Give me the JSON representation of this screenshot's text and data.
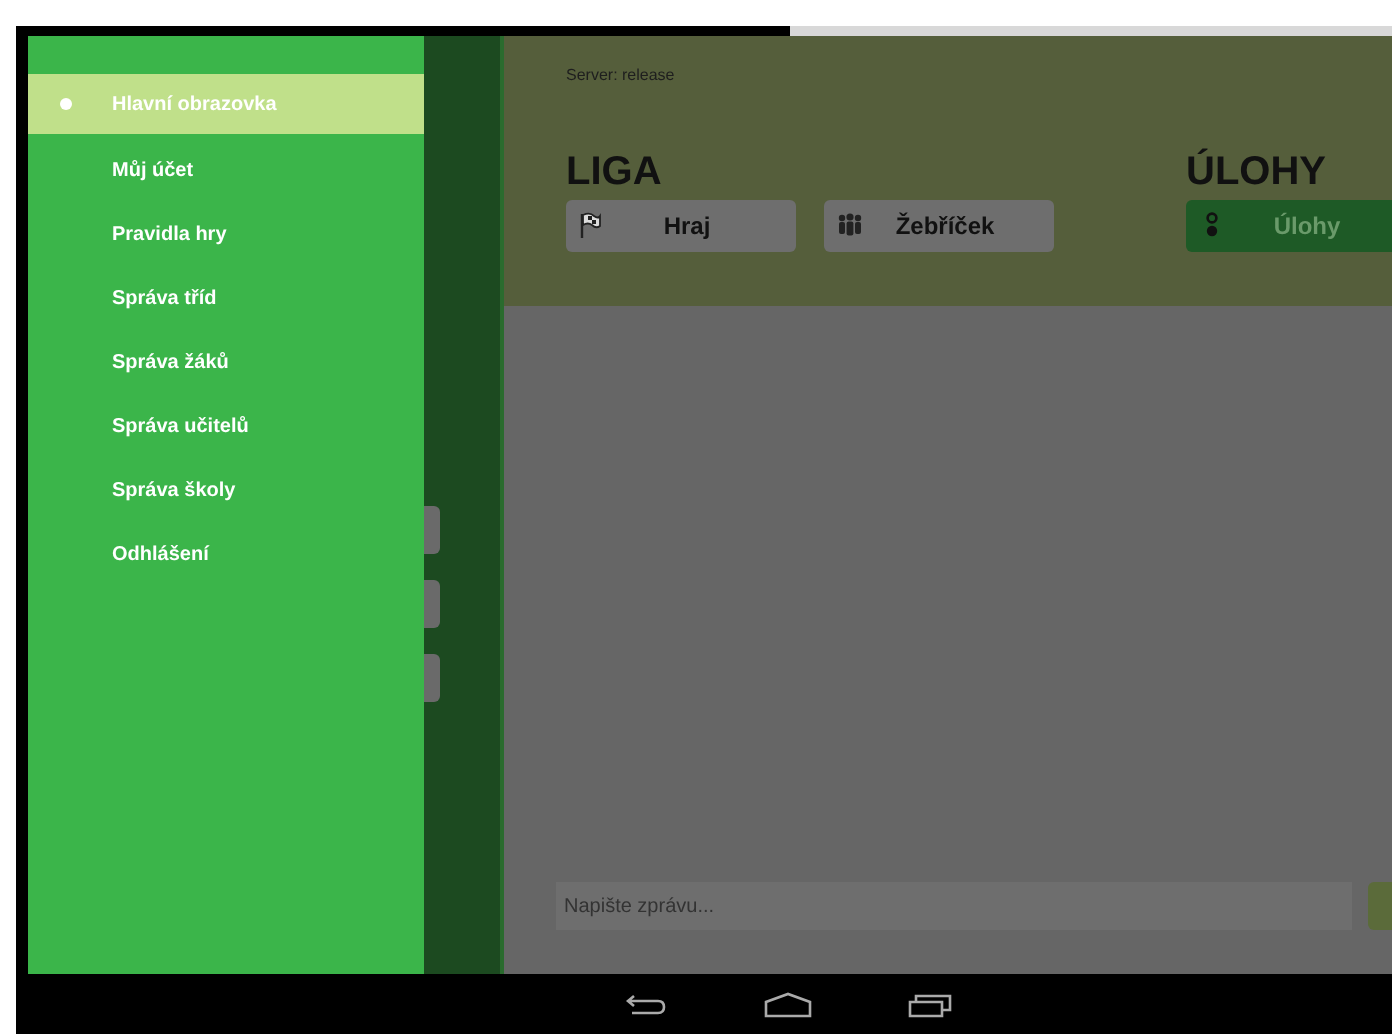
{
  "drawer": {
    "items": [
      {
        "label": "Hlavní obrazovka",
        "selected": true
      },
      {
        "label": "Můj účet",
        "selected": false
      },
      {
        "label": "Pravidla hry",
        "selected": false
      },
      {
        "label": "Správa tříd",
        "selected": false
      },
      {
        "label": "Správa žáků",
        "selected": false
      },
      {
        "label": "Správa učitelů",
        "selected": false
      },
      {
        "label": "Správa školy",
        "selected": false
      },
      {
        "label": "Odhlášení",
        "selected": false
      }
    ]
  },
  "header": {
    "server": "Server: release"
  },
  "sections": [
    {
      "title": "LIGA",
      "buttons": [
        {
          "label": "Hraj",
          "kind": "flag",
          "selected": false
        },
        {
          "label": "Žebříček",
          "kind": "people",
          "selected": false
        }
      ]
    },
    {
      "title": "ÚLOHY",
      "buttons": [
        {
          "label": "Úlohy",
          "kind": "dots",
          "selected": true
        }
      ]
    }
  ],
  "chat": {
    "placeholder": "Napište zprávu..."
  }
}
